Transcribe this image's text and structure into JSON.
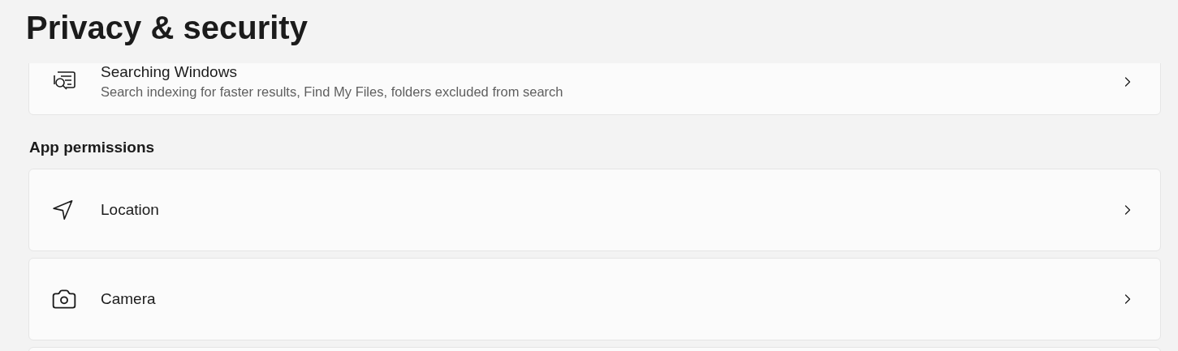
{
  "page_title": "Privacy & security",
  "sections": [
    {
      "items": [
        {
          "kind": "search",
          "title": "Searching Windows",
          "description": "Search indexing for faster results, Find My Files, folders excluded from search"
        }
      ]
    },
    {
      "heading": "App permissions",
      "items": [
        {
          "kind": "location",
          "title": "Location"
        },
        {
          "kind": "camera",
          "title": "Camera"
        }
      ]
    }
  ]
}
